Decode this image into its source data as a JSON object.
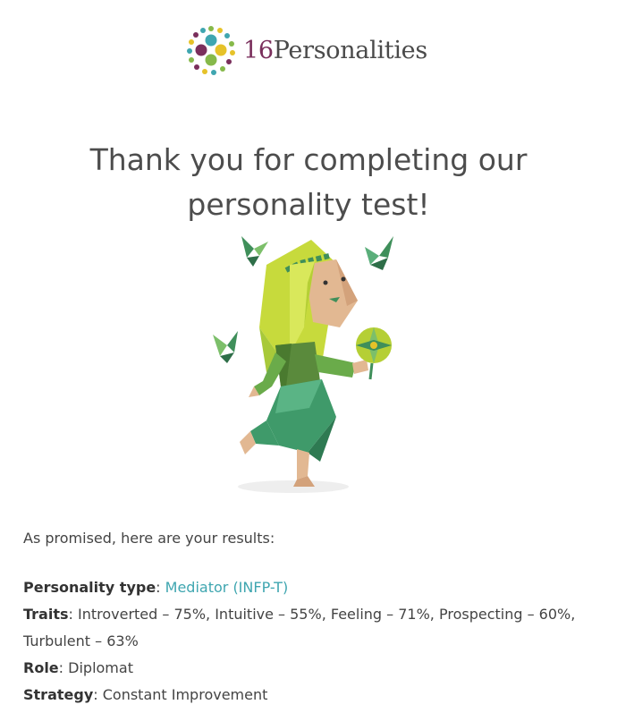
{
  "brand": {
    "number": "16",
    "name": "Personalities"
  },
  "heading": {
    "line1": "Thank you for completing our",
    "line2": "personality test!"
  },
  "intro": "As promised, here are your results:",
  "results": {
    "type_label": "Personality type",
    "type_value": "Mediator (INFP-T)",
    "traits_label": "Traits",
    "traits_value": "Introverted – 75%, Intuitive – 55%, Feeling – 71%, Prospecting – 60%, Turbulent – 63%",
    "role_label": "Role",
    "role_value": "Diplomat",
    "strategy_label": "Strategy",
    "strategy_value": "Constant Improvement"
  },
  "colors": {
    "link": "#3fa6b0",
    "brand_purple": "#7a2f5c",
    "leaf_green": "#a8c93a"
  }
}
